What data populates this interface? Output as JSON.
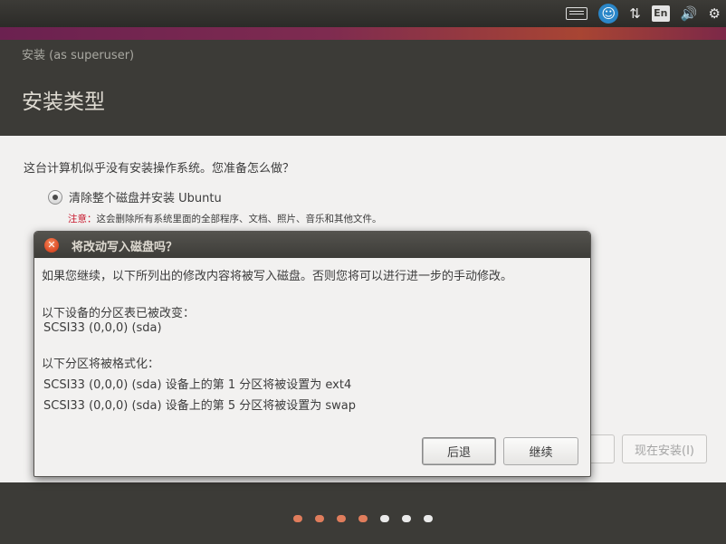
{
  "top_panel": {
    "indicators": [
      {
        "name": "keyboard-icon",
        "text": ""
      },
      {
        "name": "accessibility-icon",
        "text": "☺"
      },
      {
        "name": "network-icon",
        "text": "⇅"
      },
      {
        "name": "language-indicator",
        "text": "En"
      },
      {
        "name": "volume-icon",
        "text": "🔊"
      },
      {
        "name": "gear-icon",
        "text": "⚙"
      }
    ]
  },
  "installer": {
    "window_title": "安装 (as superuser)",
    "page_title": "安装类型",
    "question": "这台计算机似乎没有安装操作系统。您准备怎么做？",
    "option_label": "清除整个磁盘并安装 Ubuntu",
    "note_prefix": "注意：",
    "note_text": "这会删除所有系统里面的全部程序、文档、照片、音乐和其他文件。",
    "partial_back_button": ")",
    "install_now_button": "现在安装(I)"
  },
  "progress": {
    "steps_done": 4,
    "steps_total": 7
  },
  "dialog": {
    "title": "将改动写入磁盘吗？",
    "intro": "如果您继续，以下所列出的修改内容将被写入磁盘。否则您将可以进行进一步的手动修改。",
    "partition_tables_heading": "以下设备的分区表已被改变：",
    "partition_tables_devices": [
      "SCSI33 (0,0,0) (sda)"
    ],
    "format_heading": "以下分区将被格式化：",
    "format_partitions": [
      "SCSI33 (0,0,0) (sda) 设备上的第 1 分区将被设置为 ext4",
      "SCSI33 (0,0,0) (sda) 设备上的第 5 分区将被设置为 swap"
    ],
    "back_button": "后退",
    "continue_button": "继续"
  },
  "colors": {
    "aubergine": "#7e2b50",
    "accent_orange": "#e07d5c",
    "close_button": "#e0502a"
  }
}
